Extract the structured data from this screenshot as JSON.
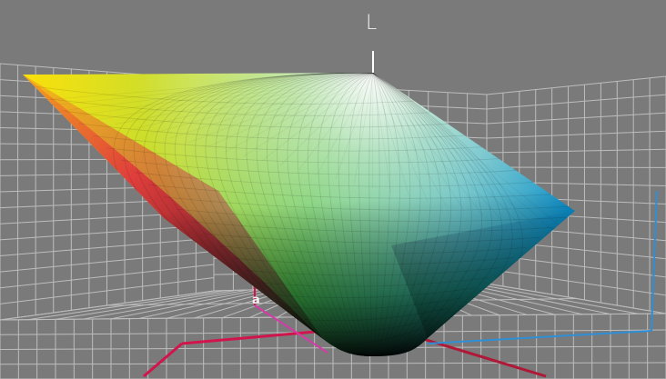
{
  "viewer": {
    "axes": {
      "l_label": "L",
      "a_label": "a"
    },
    "colors": {
      "background": "#7a7a7a",
      "grid_line": "#bdbdbd",
      "axis_a": "#d2144c",
      "axis_b": "#2e8fd6",
      "axis_l": "#ffffff"
    }
  }
}
